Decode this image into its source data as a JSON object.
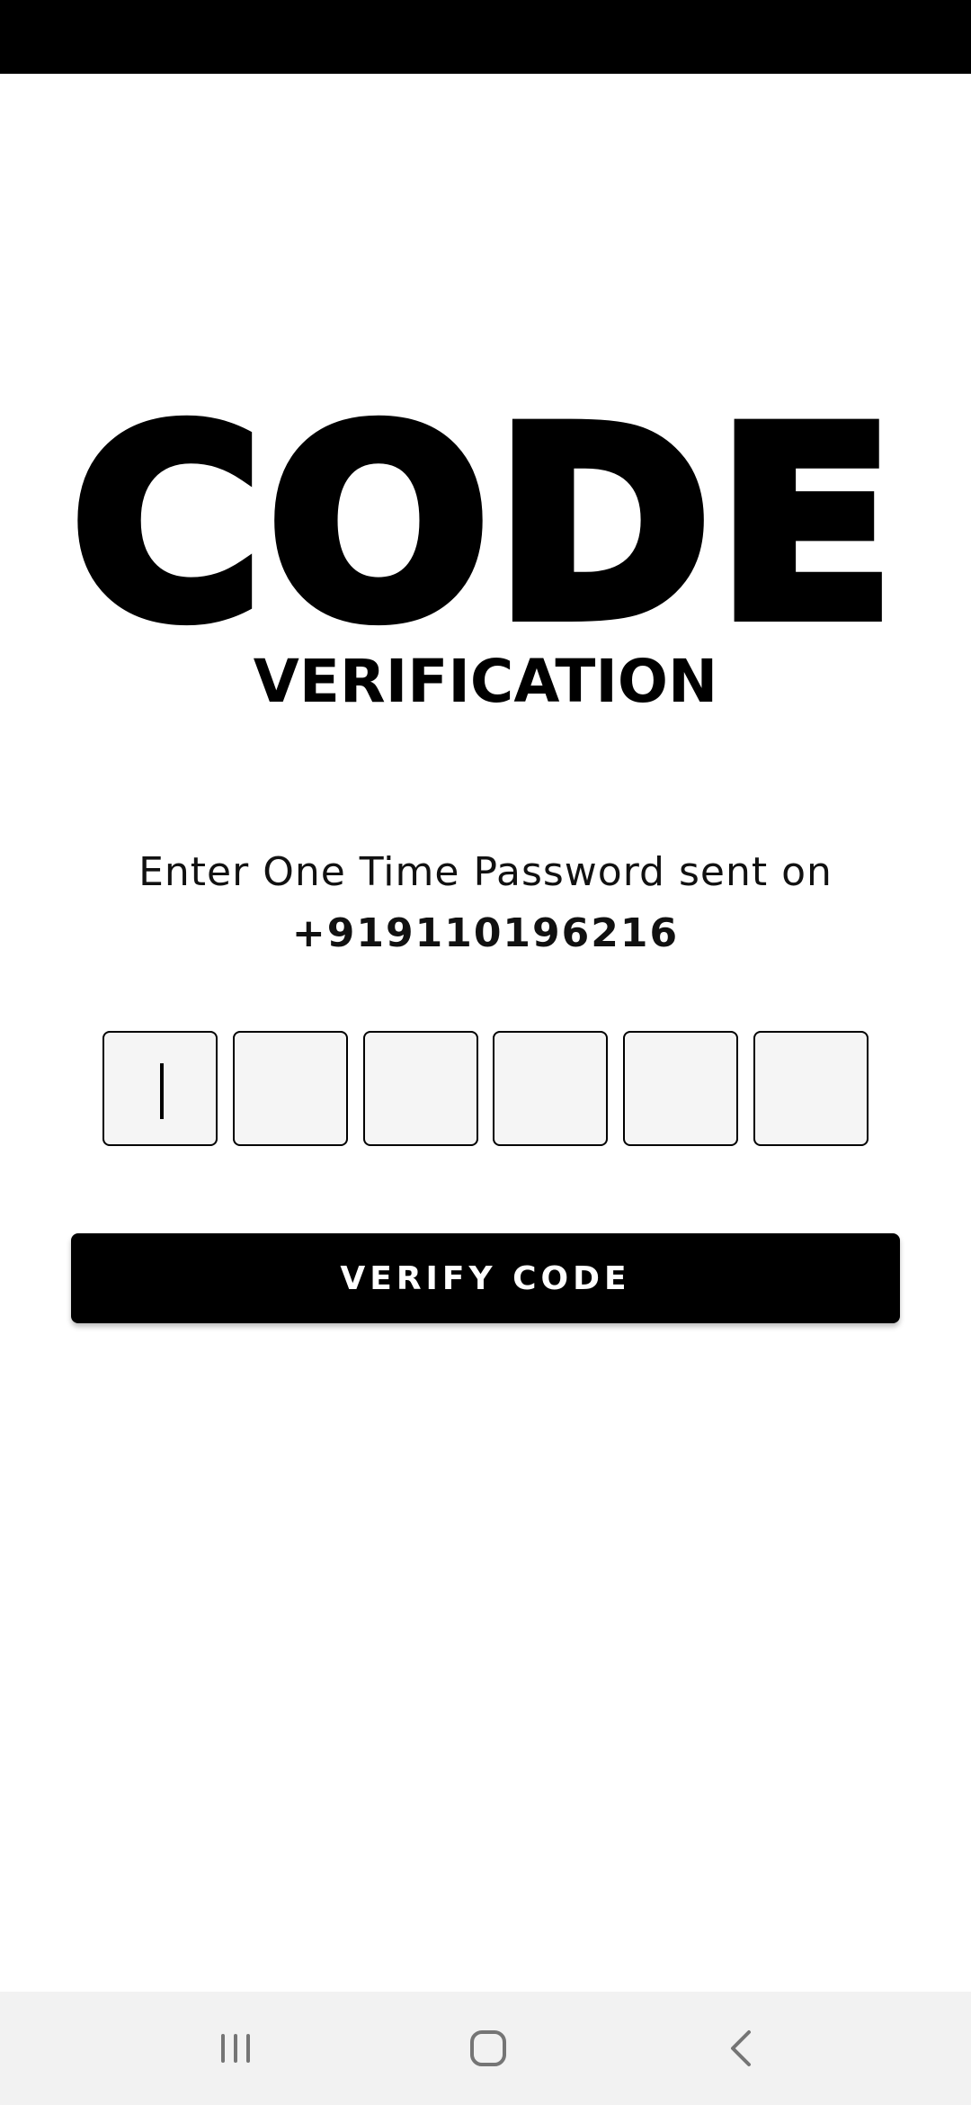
{
  "header": {
    "title": "CODE",
    "subtitle": "VERIFICATION"
  },
  "instruction": {
    "text": "Enter One Time Password sent on",
    "phone": "+919110196216"
  },
  "otp": {
    "boxes": [
      "",
      "",
      "",
      "",
      "",
      ""
    ],
    "focused_index": 0
  },
  "verify_button": {
    "label": "VERIFY CODE"
  },
  "nav_bar": {
    "icons": [
      "recents-icon",
      "home-icon",
      "back-icon"
    ]
  },
  "colors": {
    "primary": "#000000",
    "background": "#ffffff",
    "otp_fill": "#f5f5f5",
    "nav_bar": "#f2f2f2",
    "nav_icon": "#757575"
  }
}
